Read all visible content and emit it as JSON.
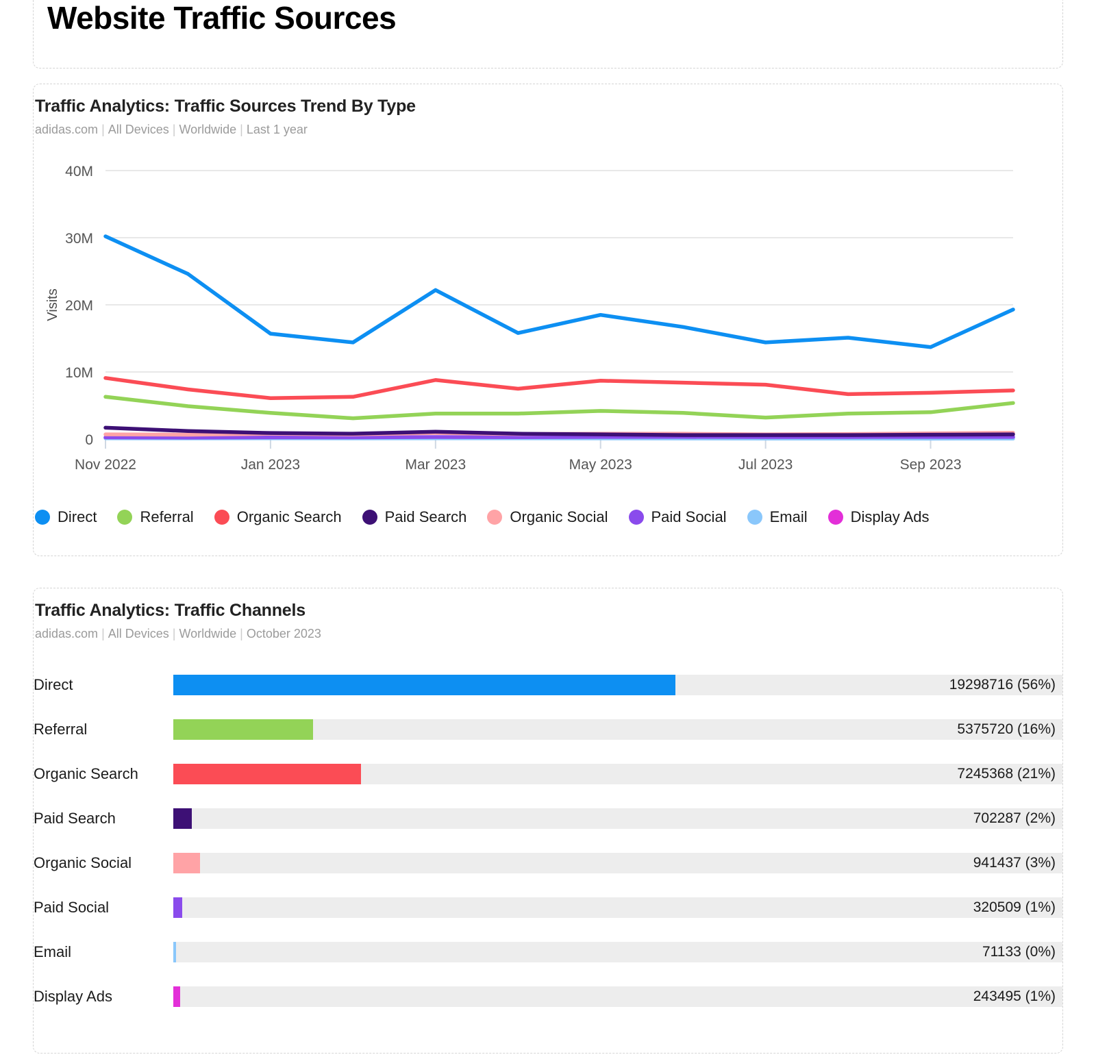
{
  "header": {
    "title": "Website Traffic Sources"
  },
  "trend_card": {
    "title": "Traffic Analytics: Traffic Sources Trend By Type",
    "subtitle_parts": [
      "adidas.com",
      "All Devices",
      "Worldwide",
      "Last 1 year"
    ],
    "subtitle": "adidas.com | All Devices | Worldwide | Last 1 year"
  },
  "channels_card": {
    "title": "Traffic Analytics: Traffic Channels",
    "subtitle_parts": [
      "adidas.com",
      "All Devices",
      "Worldwide",
      "October 2023"
    ],
    "subtitle": "adidas.com | All Devices | Worldwide | October 2023"
  },
  "colors": {
    "direct": "#0d8ff2",
    "referral": "#93d357",
    "organic_search": "#fb4c55",
    "paid_search": "#3d1075",
    "organic_social": "#ffa3a6",
    "paid_social": "#8a4bec",
    "email": "#8ac7fb",
    "display_ads": "#e32fd8"
  },
  "legend": [
    {
      "label": "Direct",
      "color": "#0d8ff2"
    },
    {
      "label": "Referral",
      "color": "#93d357"
    },
    {
      "label": "Organic Search",
      "color": "#fb4c55"
    },
    {
      "label": "Paid Search",
      "color": "#3d1075"
    },
    {
      "label": "Organic Social",
      "color": "#ffa3a6"
    },
    {
      "label": "Paid Social",
      "color": "#8a4bec"
    },
    {
      "label": "Email",
      "color": "#8ac7fb"
    },
    {
      "label": "Display Ads",
      "color": "#e32fd8"
    }
  ],
  "chart_data": [
    {
      "type": "line",
      "title": "Traffic Analytics: Traffic Sources Trend By Type",
      "subtitle": "adidas.com | All Devices | Worldwide | Last 1 year",
      "xlabel": "",
      "ylabel": "Visits",
      "ylim": [
        0,
        40000000
      ],
      "yticks": [
        0,
        10000000,
        20000000,
        30000000,
        40000000
      ],
      "ytick_labels": [
        "0",
        "10M",
        "20M",
        "30M",
        "40M"
      ],
      "grid": true,
      "legend_position": "bottom",
      "x": [
        "Nov 2022",
        "Dec 2022",
        "Jan 2023",
        "Feb 2023",
        "Mar 2023",
        "Apr 2023",
        "May 2023",
        "Jun 2023",
        "Jul 2023",
        "Aug 2023",
        "Sep 2023",
        "Oct 2023"
      ],
      "xtick_labels": [
        "Nov 2022",
        "Jan 2023",
        "Mar 2023",
        "May 2023",
        "Jul 2023",
        "Sep 2023"
      ],
      "series": [
        {
          "name": "Direct",
          "color": "#0d8ff2",
          "values": [
            30200000,
            24600000,
            15700000,
            14400000,
            22200000,
            15800000,
            18500000,
            16700000,
            14400000,
            15100000,
            13700000,
            19298716
          ]
        },
        {
          "name": "Referral",
          "color": "#93d357",
          "values": [
            6300000,
            4900000,
            3900000,
            3100000,
            3800000,
            3800000,
            4200000,
            3900000,
            3200000,
            3800000,
            4000000,
            5375720
          ]
        },
        {
          "name": "Organic Search",
          "color": "#fb4c55",
          "values": [
            9100000,
            7400000,
            6100000,
            6300000,
            8800000,
            7500000,
            8700000,
            8400000,
            8100000,
            6700000,
            6900000,
            7245368
          ]
        },
        {
          "name": "Paid Search",
          "color": "#3d1075",
          "values": [
            1700000,
            1200000,
            900000,
            800000,
            1100000,
            800000,
            700000,
            600000,
            600000,
            600000,
            650000,
            702287
          ]
        },
        {
          "name": "Organic Social",
          "color": "#ffa3a6",
          "values": [
            700000,
            650000,
            800000,
            700000,
            900000,
            750000,
            800000,
            800000,
            700000,
            750000,
            850000,
            941437
          ]
        },
        {
          "name": "Paid Social",
          "color": "#8a4bec",
          "values": [
            250000,
            220000,
            260000,
            250000,
            300000,
            280000,
            320000,
            330000,
            300000,
            310000,
            320000,
            320509
          ]
        },
        {
          "name": "Email",
          "color": "#8ac7fb",
          "values": [
            120000,
            100000,
            110000,
            100000,
            120000,
            110000,
            100000,
            95000,
            80000,
            75000,
            70000,
            71133
          ]
        },
        {
          "name": "Display Ads",
          "color": "#e32fd8",
          "values": [
            180000,
            160000,
            170000,
            160000,
            200000,
            190000,
            210000,
            230000,
            220000,
            230000,
            240000,
            243495
          ]
        }
      ]
    },
    {
      "type": "bar",
      "orientation": "horizontal",
      "title": "Traffic Analytics: Traffic Channels",
      "subtitle": "adidas.com | All Devices | Worldwide | October 2023",
      "xlabel": "",
      "ylabel": "",
      "categories": [
        "Direct",
        "Referral",
        "Organic Search",
        "Paid Search",
        "Organic Social",
        "Paid Social",
        "Email",
        "Display Ads"
      ],
      "values": [
        19298716,
        5375720,
        7245368,
        702287,
        941437,
        320509,
        71133,
        243495
      ],
      "percents": [
        56,
        16,
        21,
        2,
        3,
        1,
        0,
        1
      ],
      "value_labels": [
        "19298716 (56%)",
        "5375720 (16%)",
        "7245368 (21%)",
        "702287 (2%)",
        "941437 (3%)",
        "320509 (1%)",
        "71133 (0%)",
        "243495 (1%)"
      ],
      "colors": [
        "#0d8ff2",
        "#93d357",
        "#fb4c55",
        "#3d1075",
        "#ffa3a6",
        "#8a4bec",
        "#8ac7fb",
        "#e32fd8"
      ],
      "bar_fractions": [
        0.565,
        0.157,
        0.211,
        0.021,
        0.03,
        0.01,
        0.003,
        0.008
      ]
    }
  ],
  "channels_rows": [
    {
      "label": "Direct",
      "value_label": "19298716 (56%)",
      "color": "#0d8ff2",
      "fraction": 0.565
    },
    {
      "label": "Referral",
      "value_label": "5375720 (16%)",
      "color": "#93d357",
      "fraction": 0.157
    },
    {
      "label": "Organic Search",
      "value_label": "7245368 (21%)",
      "color": "#fb4c55",
      "fraction": 0.211
    },
    {
      "label": "Paid Search",
      "value_label": "702287 (2%)",
      "color": "#3d1075",
      "fraction": 0.021
    },
    {
      "label": "Organic Social",
      "value_label": "941437 (3%)",
      "color": "#ffa3a6",
      "fraction": 0.03
    },
    {
      "label": "Paid Social",
      "value_label": "320509 (1%)",
      "color": "#8a4bec",
      "fraction": 0.01
    },
    {
      "label": "Email",
      "value_label": "71133 (0%)",
      "color": "#8ac7fb",
      "fraction": 0.003
    },
    {
      "label": "Display Ads",
      "value_label": "243495 (1%)",
      "color": "#e32fd8",
      "fraction": 0.008
    }
  ]
}
